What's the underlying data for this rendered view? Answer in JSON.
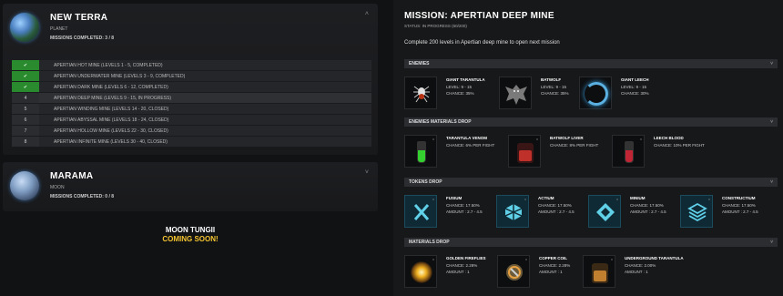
{
  "left": {
    "planet1": {
      "name": "NEW TERRA",
      "type": "PLANET",
      "missions": "MISSIONS COMPLETED: 3 / 8",
      "mines": [
        {
          "badge": "✔",
          "label": "APERTIAN HOT MINE (LEVELS 1 - 5, COMPLETED)",
          "done": true
        },
        {
          "badge": "✔",
          "label": "APERTIAN UNDERWATER MINE (LEVELS 3 - 9, COMPLETED)",
          "done": true
        },
        {
          "badge": "✔",
          "label": "APERTIAN DARK MINE (LEVELS 6 - 12, COMPLETED)",
          "done": true
        },
        {
          "badge": "4",
          "label": "APERTIAN DEEP MINE (LEVELS 9 - 15, IN PROGRESS)",
          "done": false
        },
        {
          "badge": "5",
          "label": "APERTIAN WINDING MINE (LEVELS 14 - 20, CLOSED)",
          "done": false
        },
        {
          "badge": "6",
          "label": "APERTIAN ABYSSAL MINE (LEVELS 18 - 24, CLOSED)",
          "done": false
        },
        {
          "badge": "7",
          "label": "APERTIAN HOLLOW MINE (LEVELS 22 - 30, CLOSED)",
          "done": false
        },
        {
          "badge": "8",
          "label": "APERTIAN INFINITE MINE (LEVELS 30 - 40, CLOSED)",
          "done": false
        }
      ]
    },
    "planet2": {
      "name": "MARAMA",
      "type": "MOON",
      "missions": "MISSIONS COMPLETED: 0 / 8"
    },
    "coming": {
      "line1": "MOON TUNGII",
      "line2": "COMING SOON!"
    }
  },
  "mission": {
    "title": "MISSION: APERTIAN DEEP MINE",
    "status": "STATUS: IN PROGRESS (60/200)",
    "description": "Complete 200 levels in Apertian deep mine to open next mission",
    "sections": {
      "enemies": "ENEMIES",
      "materials_drop": "ENEMIES MATERIALS DROP",
      "tokens_drop": "TOKENS DROP",
      "materials": "MATERIALS DROP"
    },
    "enemies": [
      {
        "name": "GIANT TARANTULA",
        "level": "LEVEL: 9 - 15",
        "chance": "CHANCE: 35%",
        "icon": "spider-icon"
      },
      {
        "name": "BATWOLF",
        "level": "LEVEL: 9 - 15",
        "chance": "CHANCE: 35%",
        "icon": "batwolf-icon"
      },
      {
        "name": "GIANT LEECH",
        "level": "LEVEL: 9 - 15",
        "chance": "CHANCE: 30%",
        "icon": "leech-icon"
      }
    ],
    "enemy_drops": [
      {
        "name": "TARANTULA VENOM",
        "chance": "CHANCE: 6% PER FIGHT",
        "icon": "venom-vial-icon"
      },
      {
        "name": "BATWOLF LIVER",
        "chance": "CHANCE: 8% PER FIGHT",
        "icon": "liver-jar-icon"
      },
      {
        "name": "LEECH BLOOD",
        "chance": "CHANCE: 10% PER FIGHT",
        "icon": "blood-vial-icon"
      }
    ],
    "tokens": [
      {
        "name": "FUSIUM",
        "chance": "CHANCE: 17.50%",
        "amount": "AMOUNT : 2.7 - 4.5",
        "icon": "fusium-icon"
      },
      {
        "name": "ACTIUM",
        "chance": "CHANCE: 17.50%",
        "amount": "AMOUNT : 2.7 - 4.5",
        "icon": "actium-icon"
      },
      {
        "name": "MINIUM",
        "chance": "CHANCE: 17.50%",
        "amount": "AMOUNT : 2.7 - 4.5",
        "icon": "minium-icon"
      },
      {
        "name": "CONSTRUCTIUM",
        "chance": "CHANCE: 17.50%",
        "amount": "AMOUNT : 2.7 - 4.5",
        "icon": "constructium-icon"
      }
    ],
    "materials": [
      {
        "name": "GOLDEN FIREFLIES",
        "chance": "CHANCE: 2.28%",
        "amount": "AMOUNT : 1",
        "icon": "fireflies-icon"
      },
      {
        "name": "COPPER COIL",
        "chance": "CHANCE: 2.28%",
        "amount": "AMOUNT : 1",
        "icon": "copper-coil-icon"
      },
      {
        "name": "UNDERGROUND TARANTULA",
        "chance": "CHANCE: 2.00%",
        "amount": "AMOUNT : 1",
        "icon": "tarantula-jar-icon"
      }
    ]
  }
}
